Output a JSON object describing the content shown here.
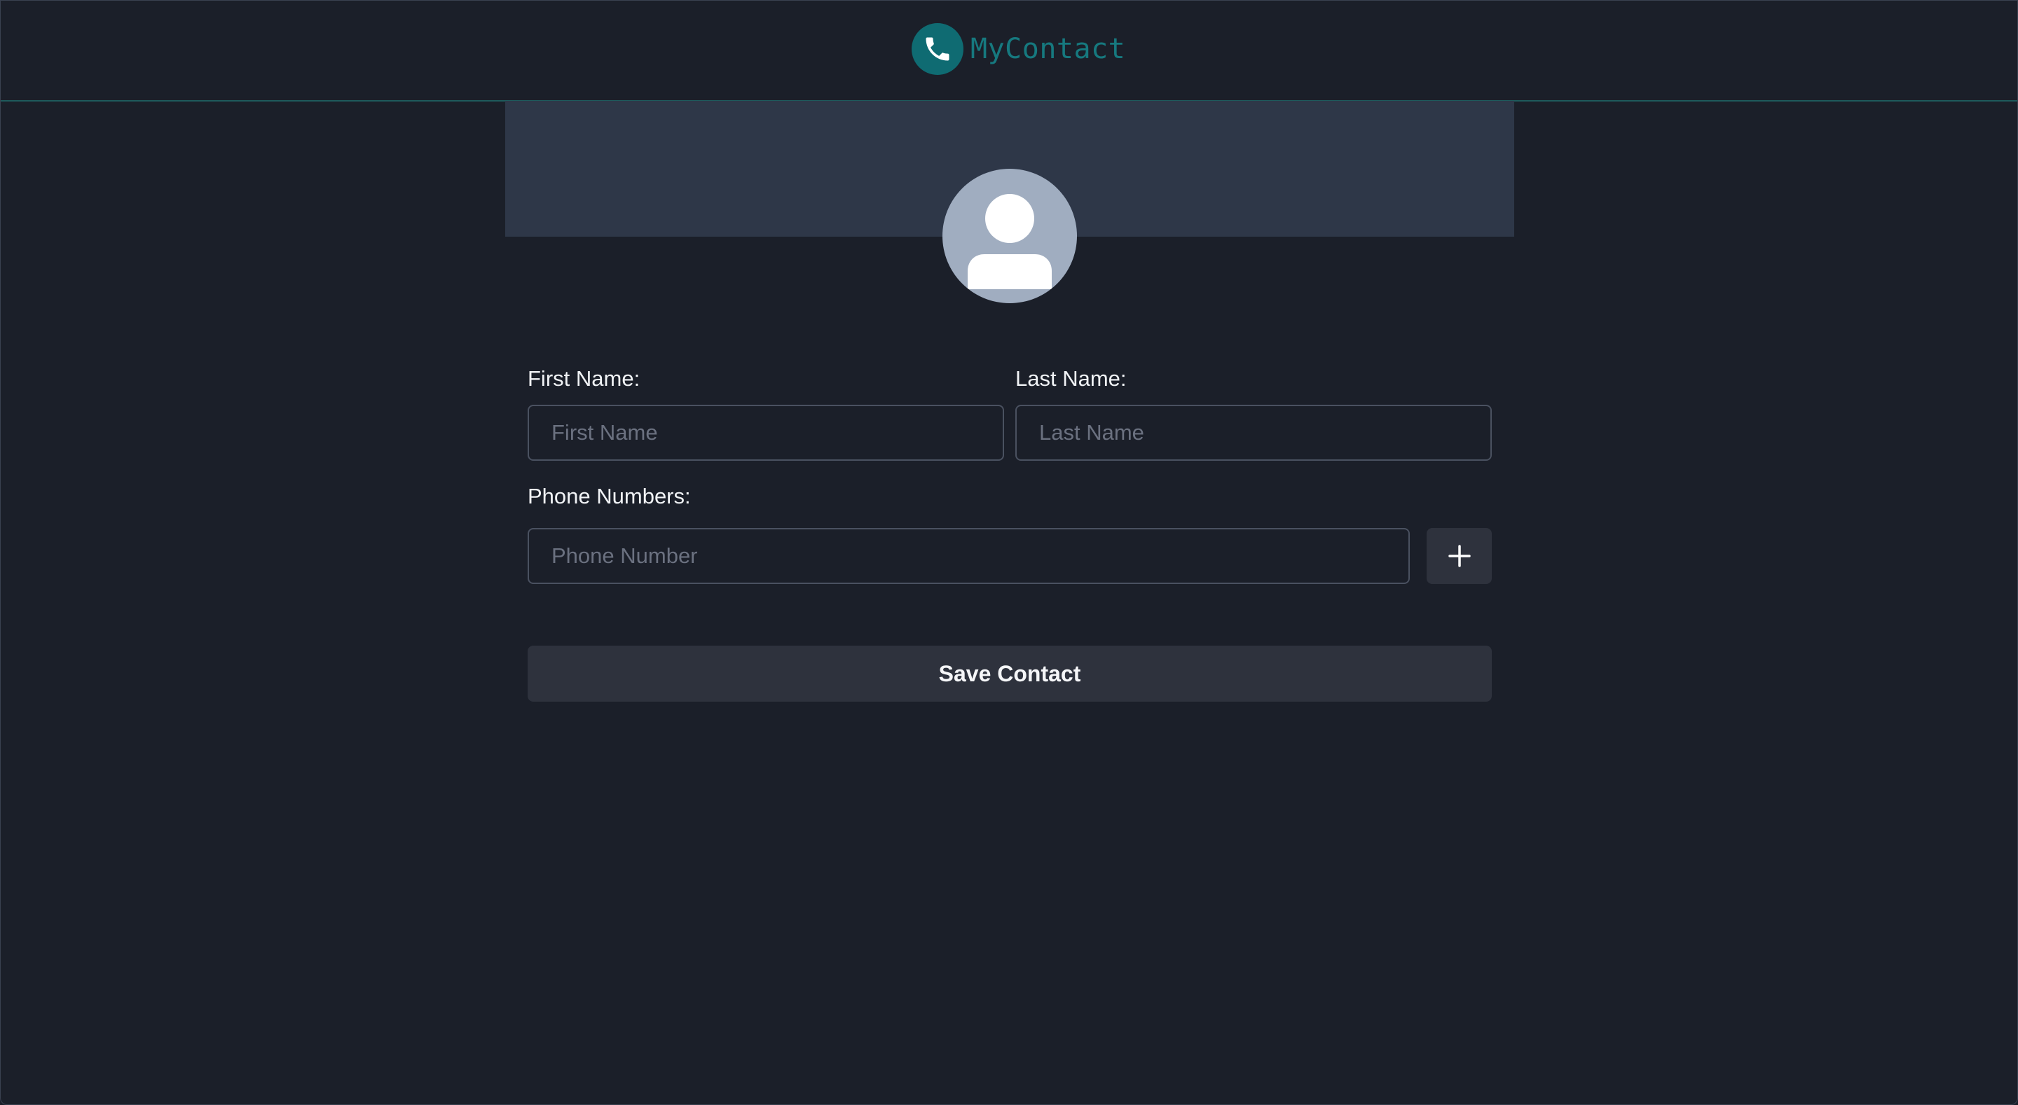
{
  "header": {
    "app_name": "MyContact",
    "logo_icon": "phone-icon"
  },
  "avatar": {
    "icon": "user-silhouette-icon"
  },
  "form": {
    "first_name": {
      "label": "First Name:",
      "placeholder": "First Name",
      "value": ""
    },
    "last_name": {
      "label": "Last Name:",
      "placeholder": "Last Name",
      "value": ""
    },
    "phone_numbers": {
      "label": "Phone Numbers:",
      "placeholder": "Phone Number",
      "value": "",
      "add_icon": "plus-icon"
    },
    "save_label": "Save Contact"
  },
  "colors": {
    "background": "#1b1f29",
    "accent": "#0f6b72",
    "banner": "#2e3748",
    "avatar": "#a0adc0",
    "button": "#2e323d"
  }
}
